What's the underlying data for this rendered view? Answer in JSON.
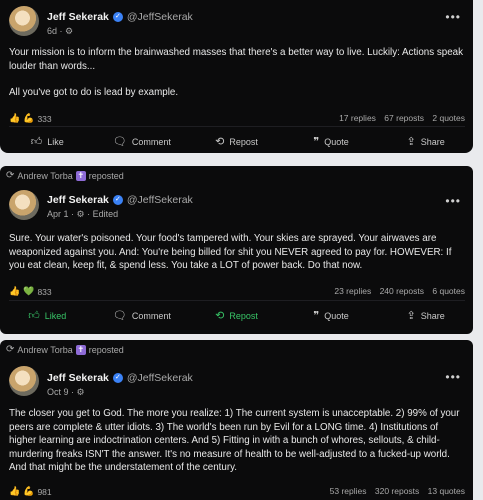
{
  "colors": {
    "card_bg": "#0b0b0c",
    "page_bg": "#e9eaed",
    "accent_green": "#38c567",
    "verified_blue": "#3b82f6"
  },
  "posts": [
    {
      "author": "Jeff Sekerak",
      "handle": "@JeffSekerak",
      "time": "6d · ⚙",
      "body": [
        "Your mission is to inform the brainwashed masses that there's a better way to live. Luckily: Actions speak louder than words...",
        "All you've got to do is lead by example."
      ],
      "reactions_count": "333",
      "replies": "17 replies",
      "reposts": "67 reposts",
      "quotes": "2 quotes",
      "actions": {
        "like": "Like",
        "comment": "Comment",
        "repost": "Repost",
        "quote": "Quote",
        "share": "Share"
      }
    },
    {
      "reposted_by": "Andrew Torba",
      "reposted_label": "reposted",
      "author": "Jeff Sekerak",
      "handle": "@JeffSekerak",
      "time": "Apr 1 · ⚙ · Edited",
      "body": [
        "Sure. Your water's poisoned. Your food's tampered with. Your skies are sprayed. Your airwaves are weaponized against you. And: You're being billed for shit you NEVER agreed to pay for. HOWEVER: If you eat clean, keep fit, & spend less. You take a LOT of power back. Do that now."
      ],
      "reactions_count": "833",
      "replies": "23 replies",
      "reposts": "240 reposts",
      "quotes": "6 quotes",
      "actions": {
        "like": "Liked",
        "comment": "Comment",
        "repost": "Repost",
        "quote": "Quote",
        "share": "Share"
      }
    },
    {
      "reposted_by": "Andrew Torba",
      "reposted_label": "reposted",
      "author": "Jeff Sekerak",
      "handle": "@JeffSekerak",
      "time": "Oct 9 · ⚙",
      "body": [
        "The closer you get to God. The more you realize: 1) The current system is unacceptable. 2) 99% of your peers are complete & utter idiots. 3) The world's been run by Evil for a LONG time. 4) Institutions of higher learning are indoctrination centers. And 5) Fitting in with a bunch of whores, sellouts, & child-murdering freaks ISN'T the answer. It's no measure of health to be well-adjusted to a fucked-up world. And that might be the understatement of the century."
      ],
      "reactions_count": "981",
      "replies": "53 replies",
      "reposts": "320 reposts",
      "quotes": "13 quotes"
    }
  ]
}
